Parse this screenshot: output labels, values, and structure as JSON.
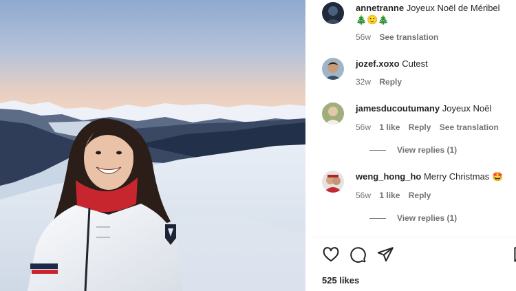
{
  "comments": [
    {
      "username": "annetranne",
      "text": "Joyeux Noël de Méribel",
      "emojis": "🎄🙂🎄",
      "time": "56w",
      "see_translation": "See translation"
    },
    {
      "username": "jozef.xoxo",
      "text": "Cutest",
      "time": "32w",
      "reply": "Reply"
    },
    {
      "username": "jamesducoutumany",
      "text": "Joyeux Noël",
      "time": "56w",
      "likes": "1 like",
      "reply": "Reply",
      "see_translation": "See translation",
      "view_replies": "View replies (1)"
    },
    {
      "username": "weng_hong_ho",
      "text": "Merry Christmas",
      "emojis": "🤩",
      "time": "56w",
      "likes": "1 like",
      "reply": "Reply",
      "view_replies": "View replies (1)"
    }
  ],
  "actions": {
    "icons": [
      "heart-icon",
      "comment-icon",
      "share-icon",
      "bookmark-icon"
    ]
  },
  "likes_count": "525 likes",
  "colors": {
    "text": "#262626",
    "secondary": "#737373",
    "divider": "#efefef"
  }
}
